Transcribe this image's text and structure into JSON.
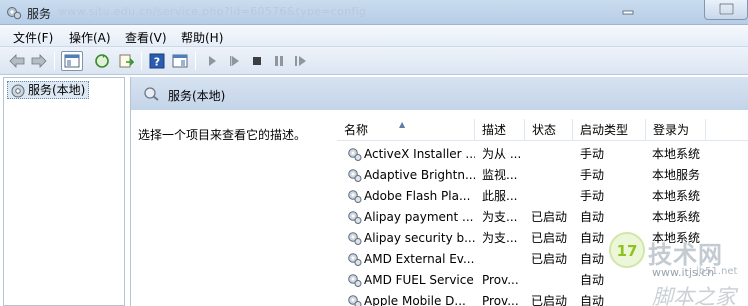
{
  "window": {
    "title": "服务",
    "blurred_url_text": "www.sjtu.edu.cn/service.php?id=60576&type=config"
  },
  "menu": [
    {
      "label": "文件(F)"
    },
    {
      "label": "操作(A)"
    },
    {
      "label": "查看(V)"
    },
    {
      "label": "帮助(H)"
    }
  ],
  "toolbar": {
    "icons": [
      "back-arrow-icon",
      "forward-arrow-icon",
      "show-tree-icon",
      "refresh-icon",
      "export-list-icon",
      "help-icon",
      "properties-icon",
      "start-service-icon",
      "start-service-alt-icon",
      "stop-service-icon",
      "pause-service-icon",
      "restart-service-icon"
    ]
  },
  "tree": {
    "selected_label": "服务(本地)"
  },
  "pane": {
    "header_title": "服务(本地)",
    "description_hint": "选择一个项目来查看它的描述。"
  },
  "table": {
    "columns": [
      "名称",
      "描述",
      "状态",
      "启动类型",
      "登录为"
    ],
    "rows": [
      {
        "name": "ActiveX Installer ...",
        "desc": "为从 ...",
        "status": "",
        "startup": "手动",
        "logon": "本地系统"
      },
      {
        "name": "Adaptive Brightn...",
        "desc": "监视...",
        "status": "",
        "startup": "手动",
        "logon": "本地服务"
      },
      {
        "name": "Adobe Flash Pla...",
        "desc": "此服...",
        "status": "",
        "startup": "手动",
        "logon": "本地系统"
      },
      {
        "name": "Alipay payment ...",
        "desc": "为支...",
        "status": "已启动",
        "startup": "自动",
        "logon": "本地系统"
      },
      {
        "name": "Alipay security b...",
        "desc": "为支...",
        "status": "已启动",
        "startup": "自动",
        "logon": "本地系统"
      },
      {
        "name": "AMD External Ev...",
        "desc": "",
        "status": "已启动",
        "startup": "自动",
        "logon": ""
      },
      {
        "name": "AMD FUEL Service",
        "desc": "Prov...",
        "status": "",
        "startup": "自动",
        "logon": ""
      },
      {
        "name": "Apple Mobile D...",
        "desc": "Prov...",
        "status": "已启动",
        "startup": "自动",
        "logon": ""
      }
    ]
  },
  "watermark": {
    "line1": "技术网",
    "line2": "www.itjs.cn",
    "line3": "脚本之家",
    "small": "jb51.net"
  },
  "colors": {
    "title_bar": "#c9dcef",
    "pane_header": "#d6e2f1",
    "selection": "#dde8f5",
    "watermark_green": "#8dc21f"
  }
}
